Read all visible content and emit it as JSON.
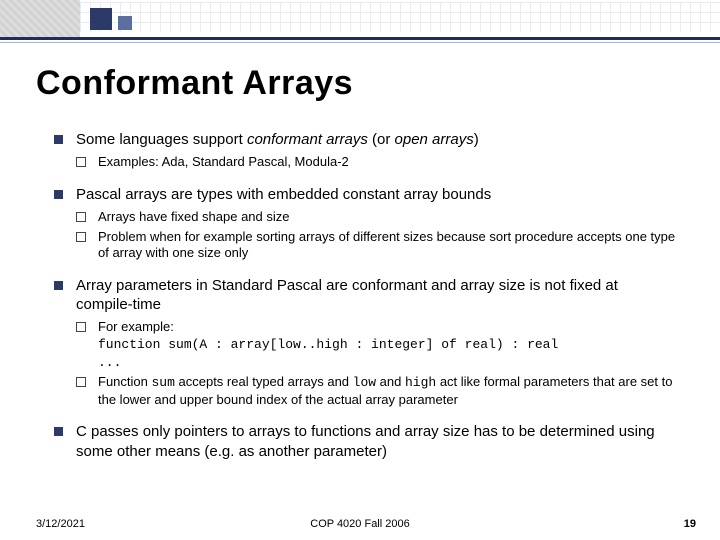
{
  "title": "Conformant Arrays",
  "bullets": {
    "b1": {
      "pre": "Some languages support ",
      "it1": "conformant arrays",
      "mid": " (or ",
      "it2": "open arrays",
      "post": ")"
    },
    "b1s1": "Examples: Ada, Standard Pascal, Modula-2",
    "b2": "Pascal arrays are types with embedded constant array bounds",
    "b2s1": "Arrays have fixed shape and size",
    "b2s2": "Problem when for example sorting arrays of different sizes because sort procedure accepts one type of array with one size only",
    "b3": "Array parameters in Standard Pascal are conformant and array size is not fixed at compile-time",
    "b3s1_label": "For example:",
    "b3s1_code1": "function sum(A : array[low..high : integer] of real) : real",
    "b3s1_code2": "...",
    "b3s2_pre": "Function ",
    "b3s2_c1": "sum",
    "b3s2_mid1": " accepts real typed arrays and ",
    "b3s2_c2": "low",
    "b3s2_mid2": " and ",
    "b3s2_c3": "high",
    "b3s2_post": " act like formal parameters that are set to the lower and upper bound index of the actual array parameter",
    "b4": "C passes only pointers to arrays to functions and array size has to be determined using some other means (e.g. as another parameter)"
  },
  "footer": {
    "date": "3/12/2021",
    "course": "COP 4020 Fall 2006",
    "page": "19"
  }
}
